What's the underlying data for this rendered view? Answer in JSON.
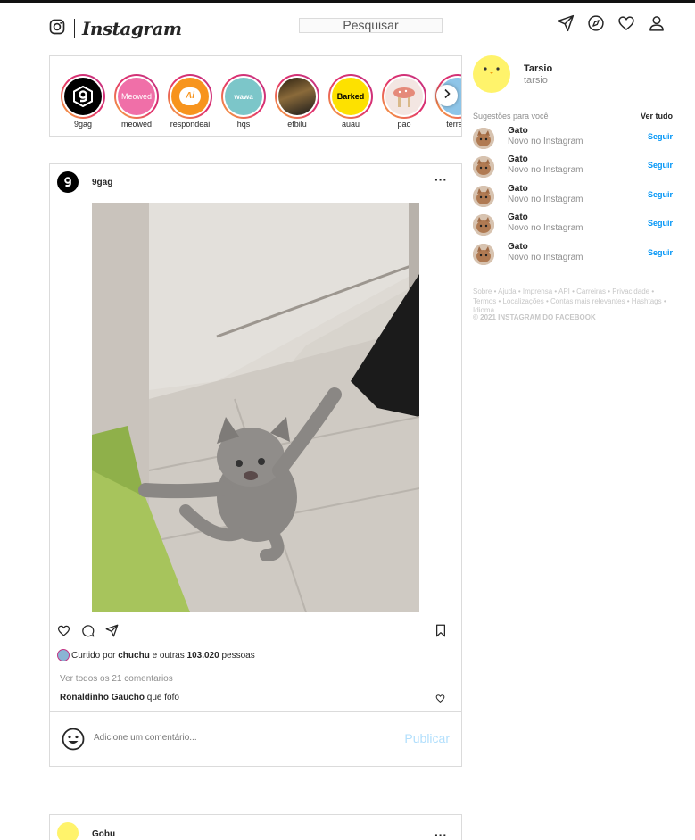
{
  "header": {
    "logo_text": "Instagram",
    "search_label": "Pesquisar"
  },
  "stories": [
    {
      "label": "9gag",
      "bg": "#000000",
      "fg": "#ffffff",
      "text": "9"
    },
    {
      "label": "meowed",
      "bg": "#f06fa8",
      "fg": "#ffffff",
      "text": "Meowed"
    },
    {
      "label": "respondeai",
      "bg": "#f7941d",
      "fg": "#ffffff",
      "text": "Ai"
    },
    {
      "label": "hqs",
      "bg": "#7cc6c9",
      "fg": "#ffffff",
      "text": "wawa"
    },
    {
      "label": "etbilu",
      "bg": "#5a4a2a",
      "fg": "#ffffff",
      "text": ""
    },
    {
      "label": "auau",
      "bg": "#fde100",
      "fg": "#000000",
      "text": "Barked"
    },
    {
      "label": "pao",
      "bg": "#f3e6e2",
      "fg": "#c0392b",
      "text": ""
    },
    {
      "label": "terrapl",
      "bg": "#8ec5e8",
      "fg": "#000000",
      "text": ""
    }
  ],
  "post": {
    "username": "9gag",
    "liked_prefix": "Curtido por",
    "liked_user": "chuchu",
    "liked_middle": "e outras",
    "liked_count": "103.020",
    "liked_suffix": "pessoas",
    "view_comments": "Ver todos os 21 comentarios",
    "comment_user": "Ronaldinho Gaucho",
    "comment_text": "que fofo",
    "comment_placeholder": "Adicione um comentário...",
    "publish_label": "Publicar"
  },
  "post2": {
    "username": "Gobu"
  },
  "sidebar": {
    "profile_name": "Tarsio",
    "profile_handle": "tarsio",
    "suggestions_title": "Sugestões para você",
    "see_all": "Ver tudo",
    "suggestions": [
      {
        "name": "Gato",
        "sub": "Novo no Instagram",
        "follow": "Seguir"
      },
      {
        "name": "Gato",
        "sub": "Novo no Instagram",
        "follow": "Seguir"
      },
      {
        "name": "Gato",
        "sub": "Novo no Instagram",
        "follow": "Seguir"
      },
      {
        "name": "Gato",
        "sub": "Novo no Instagram",
        "follow": "Seguir"
      },
      {
        "name": "Gato",
        "sub": "Novo no Instagram",
        "follow": "Seguir"
      }
    ],
    "footer_links": "Sobre • Ajuda • Imprensa • API • Carreiras • Privacidade • Termos • Localizações • Contas mais relevantes • Hashtags • Idioma",
    "copyright": "© 2021 INSTAGRAM DO FACEBOOK"
  }
}
